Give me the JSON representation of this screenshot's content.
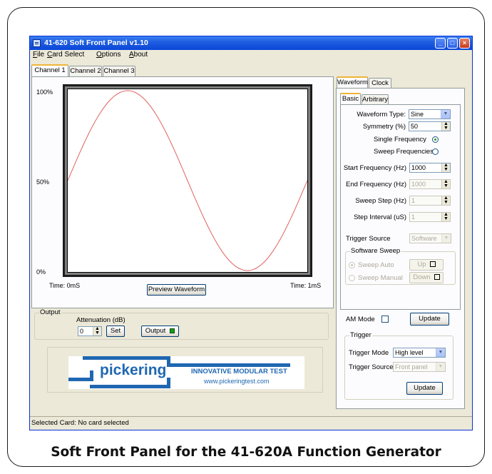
{
  "window": {
    "title": "41-620 Soft Front Panel v1.10",
    "controls": {
      "minimize": "_",
      "maximize": "□",
      "close": "×"
    }
  },
  "menu": [
    "File",
    "Card Select",
    "Options",
    "About"
  ],
  "channel_tabs": [
    "Channel 1",
    "Channel 2",
    "Channel 3"
  ],
  "waveform_plot": {
    "y_labels": [
      "100%",
      "50%",
      "0%"
    ],
    "time_start": "Time: 0mS",
    "time_end": "Time: 1mS",
    "preview_button": "Preview Waveform",
    "line_color": "#e06060",
    "waveform": "sine"
  },
  "output": {
    "group_label": "Output",
    "attenuation_label": "Attenuation (dB)",
    "attenuation_value": "0",
    "set_button": "Set",
    "output_button": "Output"
  },
  "logo": {
    "brand": "pickering",
    "tagline": "INNOVATIVE MODULAR TEST",
    "url": "www.pickeringtest.com",
    "brand_color": "#1f67b1"
  },
  "right_tabs": [
    "Waveform",
    "Clock"
  ],
  "inner_tabs": [
    "Basic",
    "Arbitrary"
  ],
  "waveform_settings": {
    "waveform_type_label": "Waveform Type:",
    "waveform_type_value": "Sine",
    "symmetry_label": "Symmetry (%)",
    "symmetry_value": "50",
    "single_freq_label": "Single Frequency",
    "sweep_freq_label": "Sweep Frequencies",
    "start_freq_label": "Start Frequency (Hz)",
    "start_freq_value": "1000",
    "end_freq_label": "End Frequency (Hz)",
    "end_freq_value": "1000",
    "sweep_step_label": "Sweep Step (Hz)",
    "sweep_step_value": "1",
    "step_interval_label": "Step Interval (uS)",
    "step_interval_value": "1",
    "trigger_source_label": "Trigger Source",
    "trigger_source_value": "Software",
    "software_sweep_label": "Software Sweep",
    "sweep_auto_label": "Sweep Auto",
    "sweep_manual_label": "Sweep Manual",
    "up_button": "Up",
    "down_button": "Down"
  },
  "am": {
    "label": "AM Mode",
    "update_button": "Update"
  },
  "trigger": {
    "group_label": "Trigger",
    "mode_label": "Trigger Mode",
    "mode_value": "High level",
    "source_label": "Trigger Source",
    "source_value": "Front panel",
    "update_button": "Update"
  },
  "status_bar": "Selected Card: No card selected",
  "caption": "Soft Front Panel for the 41-620A Function Generator"
}
